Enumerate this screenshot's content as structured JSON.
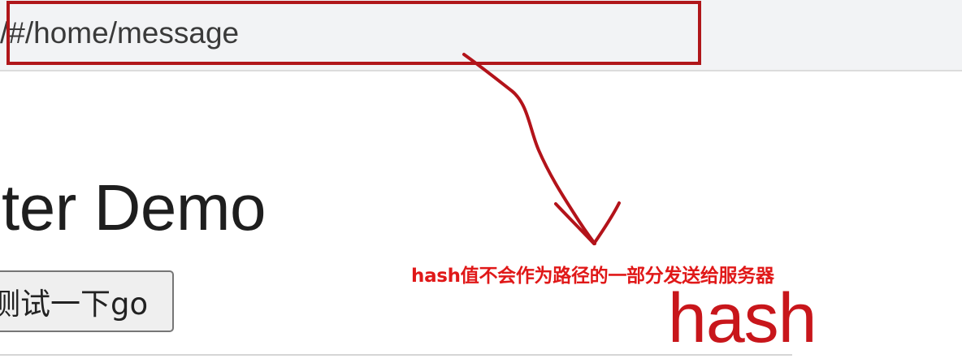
{
  "browser": {
    "url": "/#/home/message"
  },
  "main": {
    "heading": "uter Demo",
    "button_label": "测试一下go"
  },
  "annotations": {
    "note": "hash值不会作为路径的一部分发送给服务器",
    "label": "hash",
    "color": "#c8161b"
  }
}
